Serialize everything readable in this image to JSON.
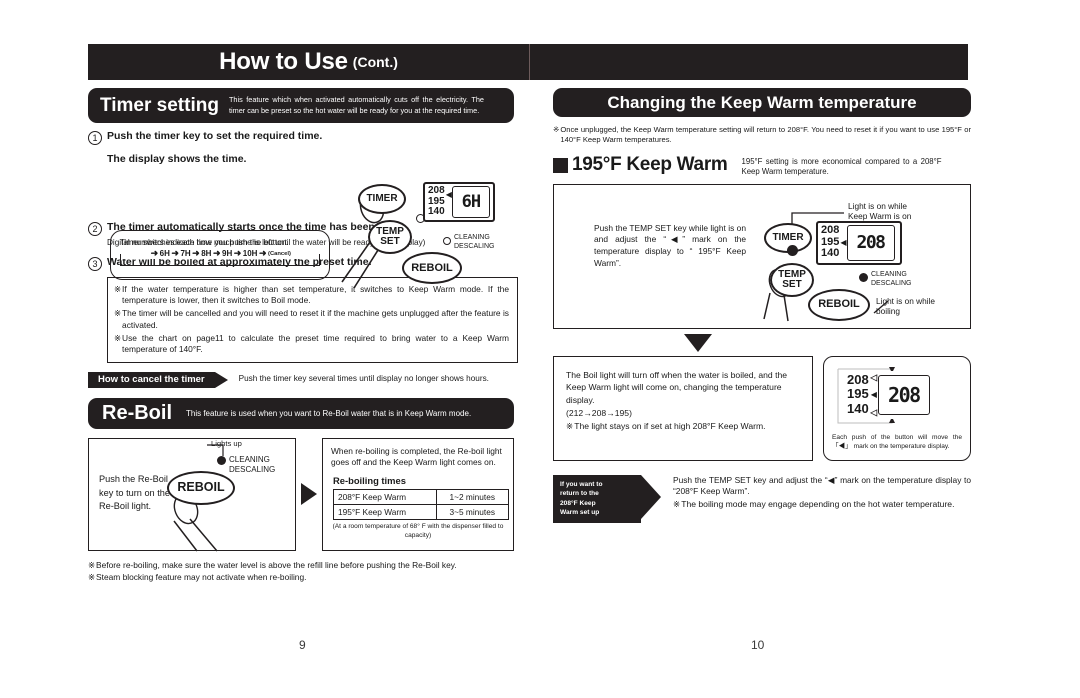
{
  "header": {
    "title": "How to Use",
    "cont": "(Cont.)"
  },
  "left_page": {
    "page_number": "9",
    "timer_banner": {
      "title": "Timer setting",
      "description": "This feature which when activated automatically cuts off the electricity. The timer can be preset so the hot water will be ready for you at the required time."
    },
    "step1": {
      "num": "1",
      "text": "Push the timer key to set the required time.",
      "sub": "The display shows the time."
    },
    "switch_box": {
      "text": "Timer switches each time you push the button.",
      "chain": [
        "6H",
        "7H",
        "8H",
        "9H",
        "10H"
      ],
      "cancel": "(Cancel)",
      "arrow": "➜"
    },
    "step2": {
      "num": "2",
      "text": "The timer automatically starts once the time has been set.",
      "sub": "Digital numbers indicate how much time is left until the water will be ready. (The display)"
    },
    "step3": {
      "num": "3",
      "text": "Water will be boiled at approximately the preset time."
    },
    "notes": [
      "If the water temperature is higher than set temperature, it switches to Keep Warm mode. If the temperature is lower, then it switches to Boil mode.",
      "The timer will be cancelled and you will need to reset it if the machine gets unplugged after the feature is activated.",
      "Use the chart on page11 to calculate the preset time required to bring water to a Keep Warm temperature of 140°F."
    ],
    "cancel_tag": {
      "label": "How to cancel the timer",
      "text": "Push the timer key several times until display no longer shows hours."
    },
    "reboil_banner": {
      "title": "Re-Boil",
      "description": "This feature is used when you want to Re-Boil water that is in Keep Warm mode."
    },
    "reboil_left": {
      "text": "Push the Re-Boil key to turn on the Re-Boil light.",
      "lights_up": "Lights up",
      "cleaning": "CLEANING",
      "descaling": "DESCALING",
      "reboil_btn": "REBOIL"
    },
    "reboil_right": {
      "text": "When re-boiling is completed, the Re-boil light goes off and the Keep Warm light comes on.",
      "table_title": "Re-boiling times",
      "rows": [
        {
          "mode": "208°F Keep Warm",
          "time": "1~2 minutes"
        },
        {
          "mode": "195°F Keep Warm",
          "time": "3~5 minutes"
        }
      ],
      "footnote": "(At a room temperature of 68° F with the dispenser filled to capacity)"
    },
    "bottom_notes": [
      "Before re-boiling, make sure the water level is above the refill line before pushing the Re-Boil key.",
      "Steam blocking feature may not activate when re-boiling."
    ],
    "panel": {
      "timer_btn": "TIMER",
      "temp_btn_line1": "TEMP",
      "temp_btn_line2": "SET",
      "reboil_btn": "REBOIL",
      "cleaning": "CLEANING",
      "descaling": "DESCALING",
      "lcd_temps": [
        "208",
        "195",
        "140"
      ],
      "lcd_value": "6H"
    }
  },
  "right_page": {
    "page_number": "10",
    "kw_banner": {
      "title": "Changing the Keep Warm temperature"
    },
    "kw_note": "Once unplugged, the Keep Warm temperature setting will return to 208°F. You need to reset it if you want to use 195°F or 140°F Keep Warm temperatures.",
    "section": {
      "title": "195°F Keep Warm",
      "subtitle": "195°F setting is more economical compared to a 208°F Keep Warm temperature."
    },
    "panel_copy": "Push the TEMP SET key while light is on and adjust the “◀” mark on the temperature display to “ 195°F Keep Warm”.",
    "panel": {
      "timer_btn": "TIMER",
      "temp_btn_line1": "TEMP",
      "temp_btn_line2": "SET",
      "reboil_btn": "REBOIL",
      "cleaning": "CLEANING",
      "descaling": "DESCALING",
      "lcd_temps": [
        "208",
        "195",
        "140"
      ],
      "lcd_value": "208",
      "callout_keepwarm": "Light is on while\nKeep Warm is on",
      "callout_boiling": "Light is on while\nboiling"
    },
    "lower_left": {
      "line1": "The Boil light will turn off when the water is boiled, and the Keep Warm light will come on, changing the temperature display.",
      "line2": "(212→208→195)",
      "line3": "The light stays on if set at high 208°F Keep Warm."
    },
    "lower_right": {
      "lcd_temps": [
        "208",
        "195",
        "140"
      ],
      "lcd_value": "208",
      "caption": "Each push of the button will move the 「◀」 mark on the temperature display."
    },
    "return_tag": {
      "label": "If you want to\nreturn to the\n208°F Keep\nWarm set up",
      "line1": "Push the TEMP SET key and adjust the “◀” mark on the temperature display to “208°F Keep Warm”.",
      "line2": "The boiling mode may engage depending on the hot water temperature."
    }
  },
  "symbols": {
    "note_mark": "※",
    "left_tri": "◀"
  }
}
